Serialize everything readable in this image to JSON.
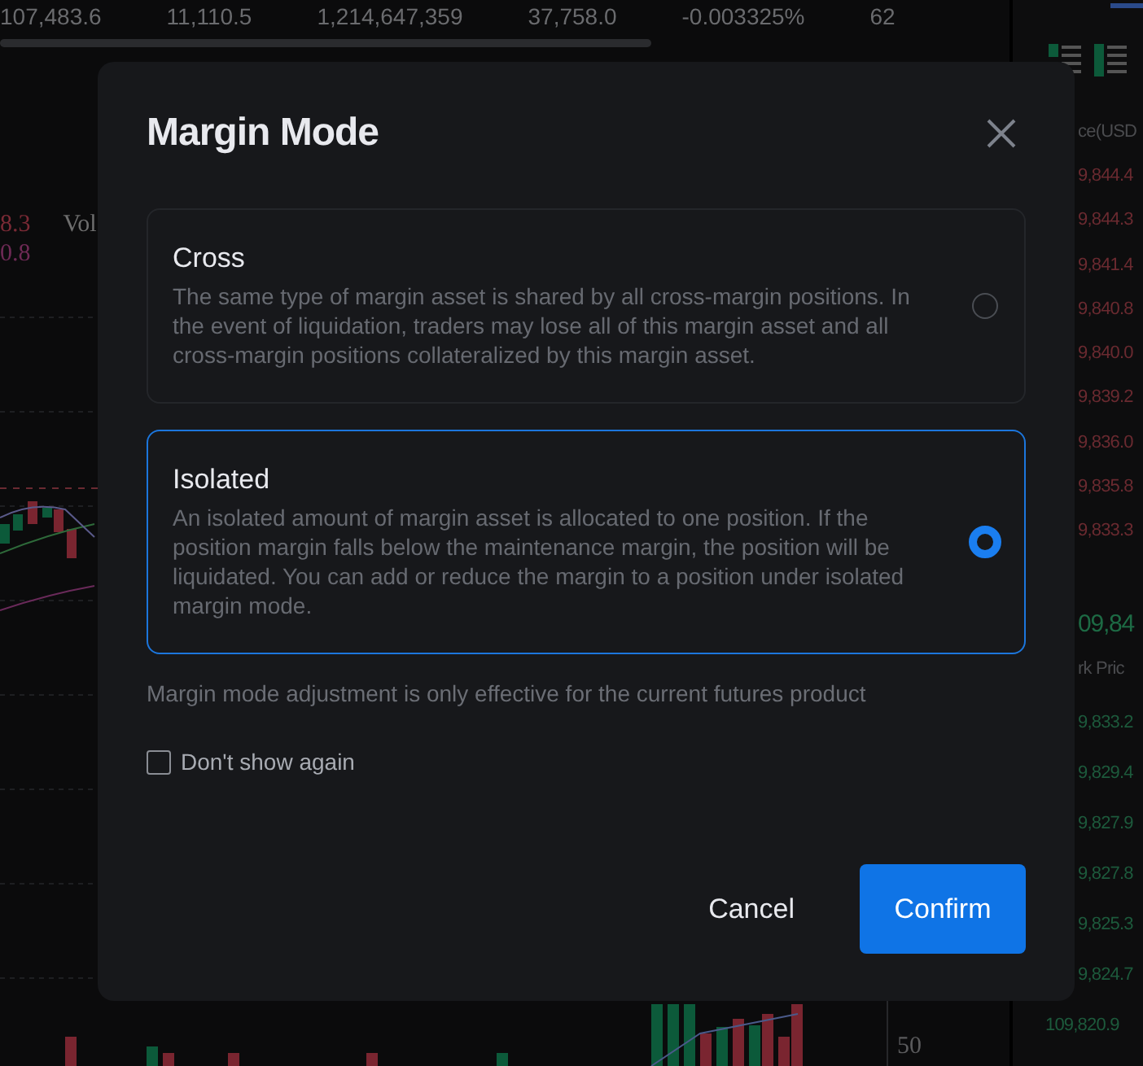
{
  "market_stats": [
    "107,483.6",
    "11,110.5",
    "1,214,647,359",
    "37,758.0",
    "-0.003325%",
    "62"
  ],
  "chart": {
    "legend": [
      {
        "text": "8.3",
        "color": "#7a2a35"
      },
      {
        "text": "Vol",
        "color": "#6e6e6e"
      },
      {
        "text": "0.8",
        "color": "#6e2a55"
      }
    ],
    "axis_label": "50"
  },
  "order_book": {
    "header": "ce(USD",
    "asks": [
      "9,844.4",
      "9,844.3",
      "9,841.4",
      "9,840.8",
      "9,840.0",
      "9,839.2",
      "9,836.0",
      "9,835.8",
      "9,833.3"
    ],
    "last_price": "09,84",
    "mark_price_label": "rk Pric",
    "bids": [
      "9,833.2",
      "9,829.4",
      "9,827.9",
      "9,827.8",
      "9,825.3",
      "9,824.7",
      "109,820.9"
    ]
  },
  "dialog": {
    "title": "Margin Mode",
    "options": [
      {
        "title": "Cross",
        "description": "The same type of margin asset is shared by all cross-margin positions. In the event of liquidation, traders may lose all of this margin asset and all cross-margin positions collateralized by this margin asset.",
        "selected": false
      },
      {
        "title": "Isolated",
        "description": "An isolated amount of margin asset is allocated to one position. If the position margin falls below the maintenance margin, the position will be liquidated. You can add or reduce the margin to a position under isolated margin mode.",
        "selected": true
      }
    ],
    "note": "Margin mode adjustment is only effective for the current futures product",
    "dont_show_again": {
      "label": "Don't show again",
      "checked": false
    },
    "buttons": [
      {
        "label": "Cancel",
        "kind": "secondary"
      },
      {
        "label": "Confirm",
        "kind": "primary"
      }
    ]
  }
}
